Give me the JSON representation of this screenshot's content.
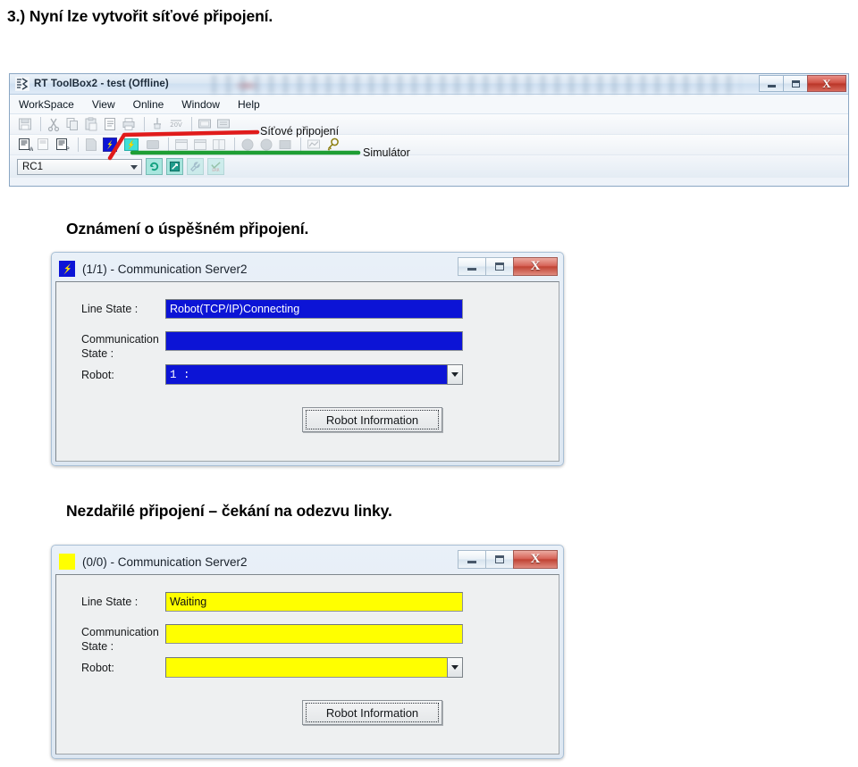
{
  "document": {
    "step_heading": "3.) Nyní lze vytvořit síťové připojení.",
    "caption_success": "Oznámení o úspěšném připojení.",
    "caption_failed": "Nezdařilé připojení – čekání na odezvu linky."
  },
  "rt_toolbox": {
    "title": "RT ToolBox2 - test  (Offline)",
    "app_icon": "rt-toolbox-icon",
    "window_buttons": {
      "minimize": "minimize-icon",
      "maximize": "maximize-icon",
      "close": "close-icon",
      "close_glyph": "X"
    },
    "menu": [
      {
        "label": "WorkSpace"
      },
      {
        "label": "View"
      },
      {
        "label": "Online"
      },
      {
        "label": "Window"
      },
      {
        "label": "Help"
      }
    ],
    "toolbar_row1": [
      "save-icon",
      "cut-icon",
      "copy-icon",
      "paste-icon",
      "document-icon",
      "print-icon",
      "tool-icon",
      "unit-20v-icon",
      "monitor-icon",
      "monitor2-icon"
    ],
    "toolbar_row2": [
      "workspace-new-icon",
      "workspace-open-icon",
      "project-icon",
      "page-icon",
      "network-connect-icon",
      "simulator-icon",
      "program-icon",
      "window1-icon",
      "window2-icon",
      "window3-icon",
      "circle1-icon",
      "circle2-icon",
      "block-icon",
      "chart-icon",
      "key-icon"
    ],
    "status_row": {
      "robot_controller": "RC1",
      "dropdown_icon": "chevron-down-icon",
      "buttons": [
        "refresh-icon",
        "edit-icon",
        "wrench-icon",
        "error-icon"
      ]
    },
    "annotations": {
      "network_label": "Síťové připojení",
      "network_line_color": "#e01b1b",
      "simulator_label": "Simulátor",
      "simulator_line_color": "#1e9e34"
    }
  },
  "dialogs": [
    {
      "id": "success",
      "icon": "lightning-bolt-icon",
      "icon_color": "#0c14d6",
      "title": "(1/1) - Communication Server2",
      "window_buttons": {
        "minimize": "minimize-icon",
        "maximize": "maximize-icon",
        "close": "close-icon",
        "close_glyph": "X"
      },
      "fields": {
        "line_state_label": "Line State :",
        "line_state_value": "Robot(TCP/IP)Connecting",
        "communication_state_label": "Communication\nState :",
        "communication_state_line1": "Communication",
        "communication_state_line2": "State :",
        "communication_state_value": "",
        "robot_label": "Robot:",
        "robot_value": "1 :",
        "robot_dropdown_icon": "chevron-down-icon"
      },
      "button_label": "Robot Information",
      "field_bg": "#0c14d6",
      "field_fg": "#ffffff"
    },
    {
      "id": "waiting",
      "icon": "yellow-square-icon",
      "icon_color": "#ffff00",
      "title": "(0/0) - Communication Server2",
      "window_buttons": {
        "minimize": "minimize-icon",
        "maximize": "maximize-icon",
        "close": "close-icon",
        "close_glyph": "X"
      },
      "fields": {
        "line_state_label": "Line State :",
        "line_state_value": "Waiting",
        "communication_state_line1": "Communication",
        "communication_state_line2": "State :",
        "communication_state_value": "",
        "robot_label": "Robot:",
        "robot_value": "",
        "robot_dropdown_icon": "chevron-down-icon"
      },
      "button_label": "Robot Information",
      "field_bg": "#ffff00",
      "field_fg": "#101010"
    }
  ]
}
